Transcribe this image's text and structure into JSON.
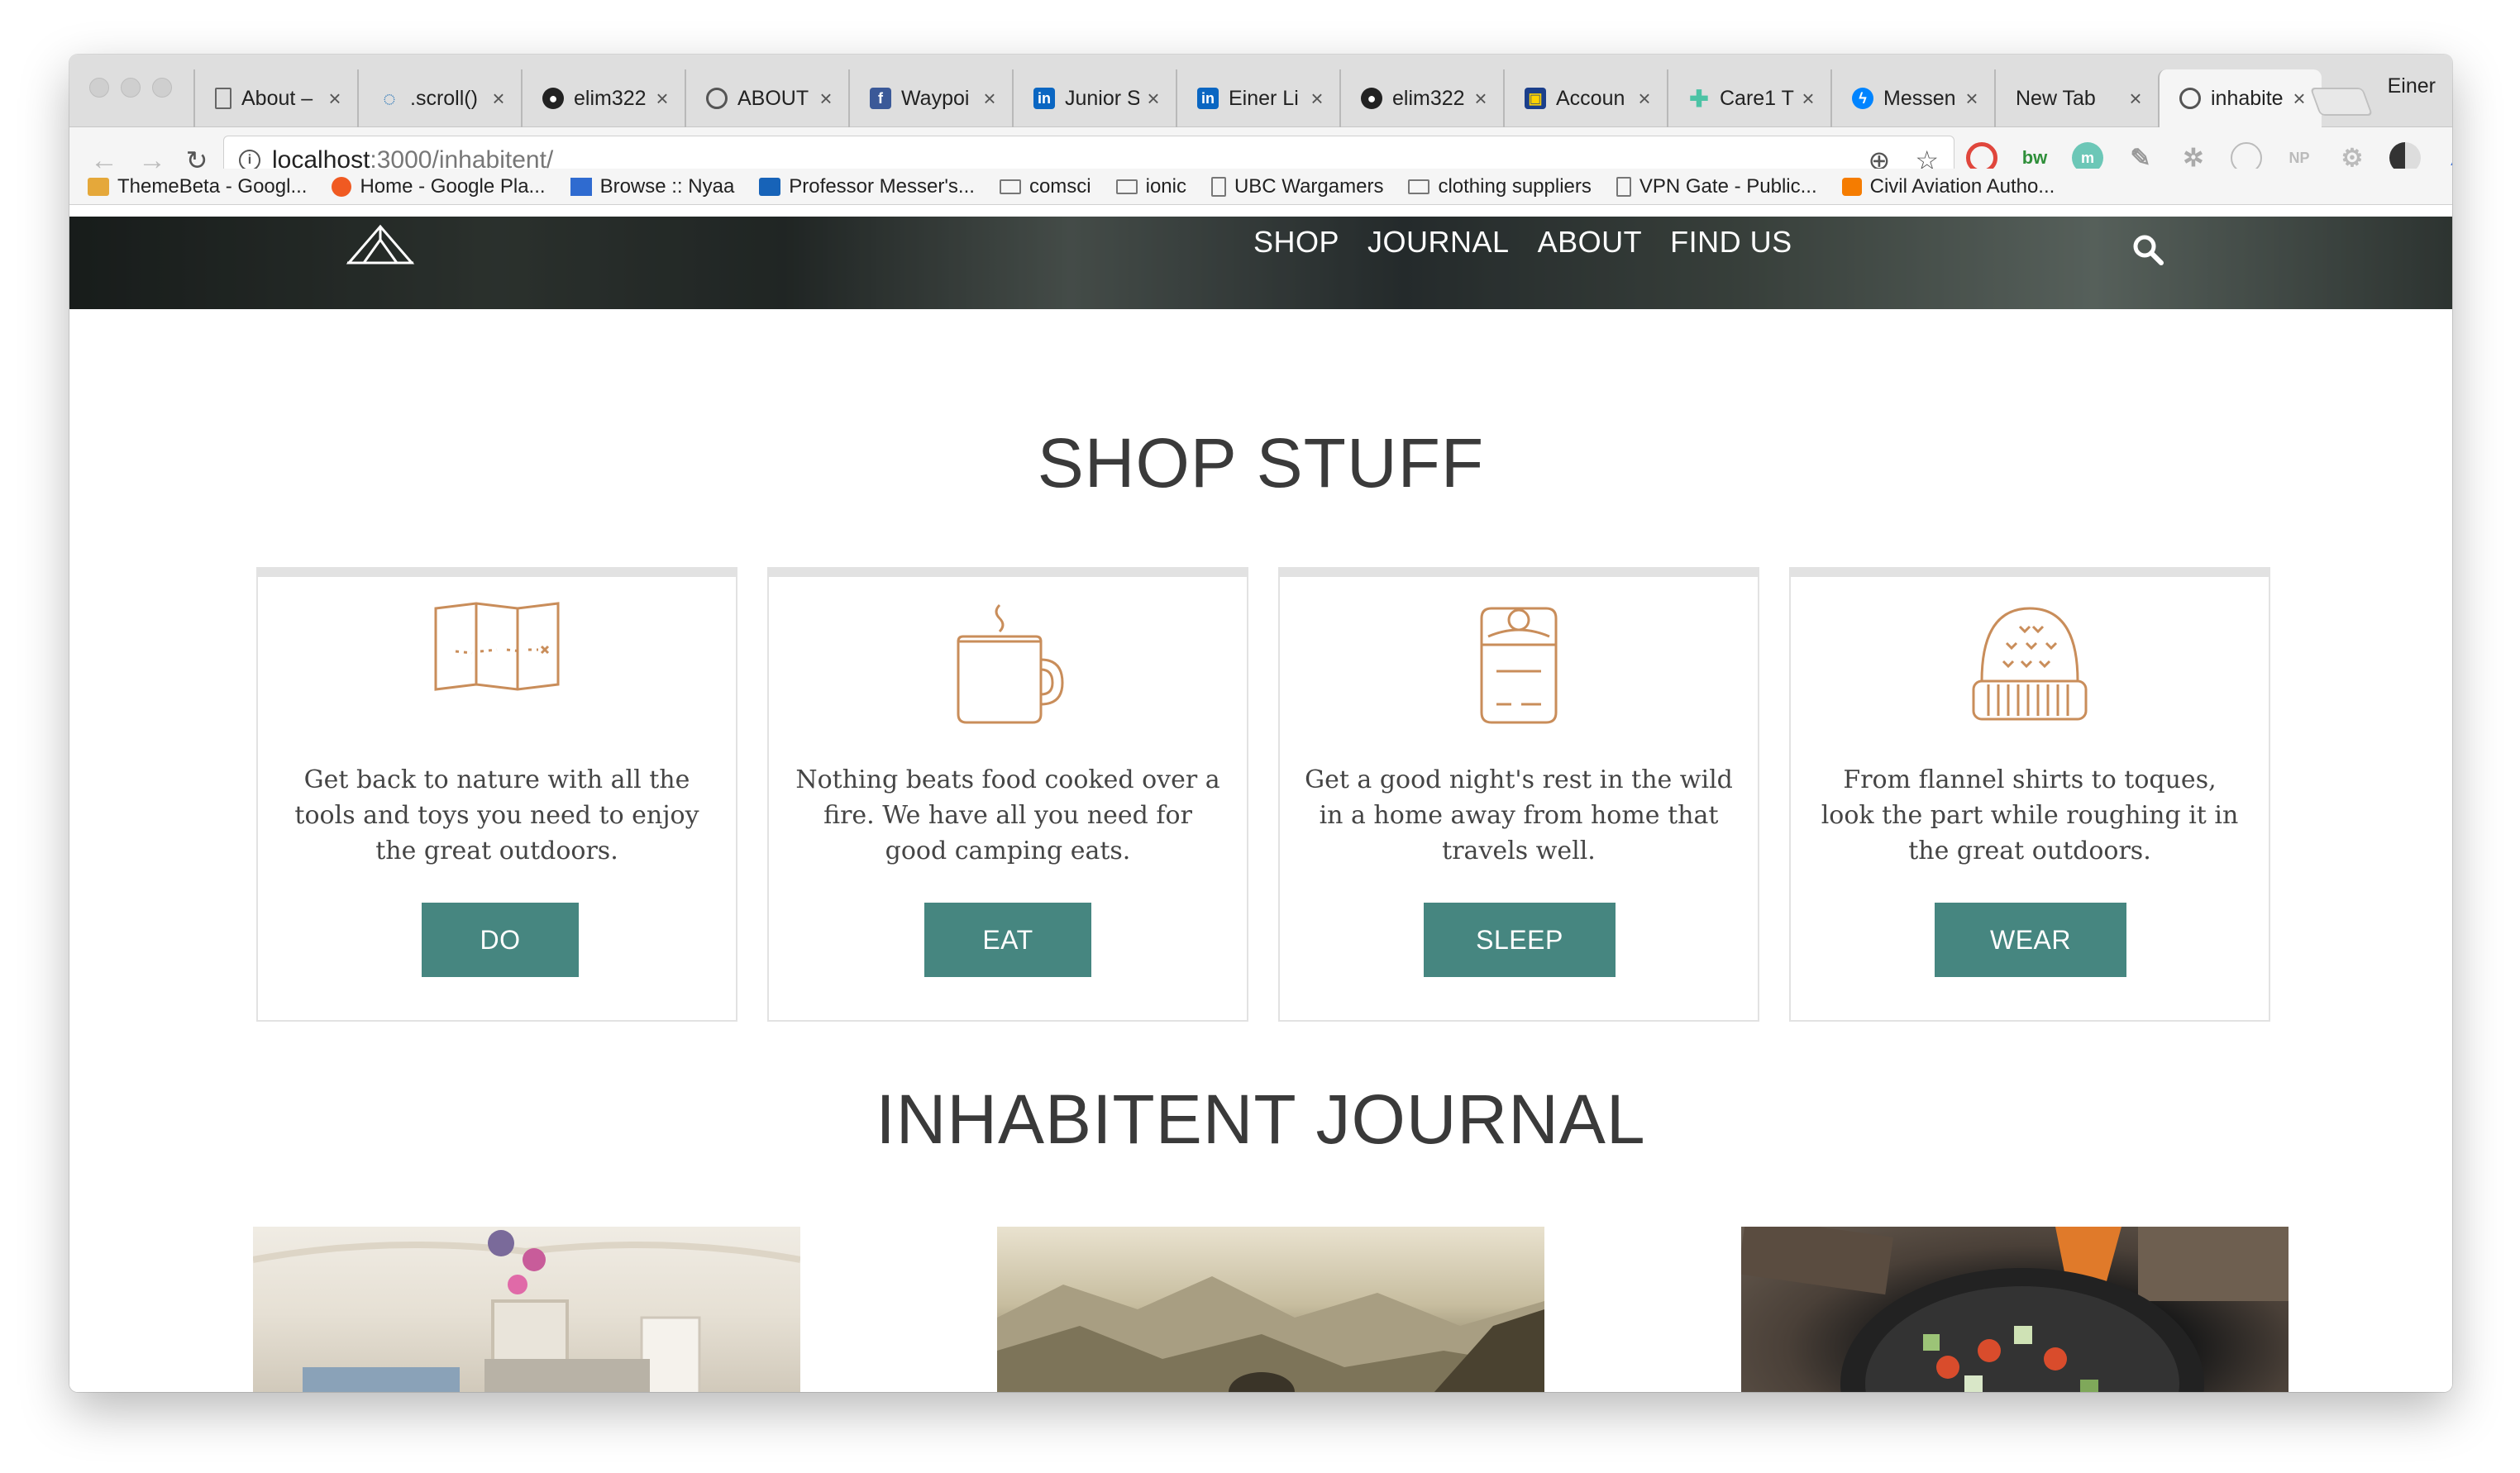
{
  "browser": {
    "profile_name": "Einer",
    "tabs": [
      {
        "title": "About –",
        "icon": "page-icon",
        "active": false
      },
      {
        "title": ".scroll()",
        "icon": "jquery-icon",
        "active": false
      },
      {
        "title": "elim322",
        "icon": "github-icon",
        "active": false
      },
      {
        "title": "ABOUT",
        "icon": "globe-icon",
        "active": false
      },
      {
        "title": "Waypoi",
        "icon": "facebook-icon",
        "active": false
      },
      {
        "title": "Junior S",
        "icon": "linkedin-icon",
        "active": false
      },
      {
        "title": "Einer Li",
        "icon": "linkedin-icon",
        "active": false
      },
      {
        "title": "elim322",
        "icon": "github-icon",
        "active": false
      },
      {
        "title": "Accoun",
        "icon": "bank-icon",
        "active": false
      },
      {
        "title": "Care1 T",
        "icon": "care-icon",
        "active": false
      },
      {
        "title": "Messen",
        "icon": "messenger-icon",
        "active": false
      },
      {
        "title": "New Tab",
        "icon": "",
        "active": false
      },
      {
        "title": "inhabite",
        "icon": "globe-icon",
        "active": true
      }
    ],
    "url_host": "localhost",
    "url_path": ":3000/inhabitent/",
    "bookmarks": [
      {
        "label": "ThemeBeta - Googl...",
        "icon": "themebeta-icon"
      },
      {
        "label": "Home - Google Pla...",
        "icon": "google-play-icon"
      },
      {
        "label": "Browse :: Nyaa",
        "icon": "nyaa-icon"
      },
      {
        "label": "Professor Messer's...",
        "icon": "messer-icon"
      },
      {
        "label": "comsci",
        "icon": "folder-icon"
      },
      {
        "label": "ionic",
        "icon": "folder-icon"
      },
      {
        "label": "UBC Wargamers",
        "icon": "page-icon"
      },
      {
        "label": "clothing suppliers",
        "icon": "folder-icon"
      },
      {
        "label": "VPN Gate - Public...",
        "icon": "page-icon"
      },
      {
        "label": "Civil Aviation Autho...",
        "icon": "blogger-icon"
      }
    ]
  },
  "site": {
    "nav": [
      "SHOP",
      "JOURNAL",
      "ABOUT",
      "FIND US"
    ],
    "shop_title": "SHOP STUFF",
    "journal_title": "INHABITENT JOURNAL",
    "accent_color": "#468680",
    "icon_color": "#c98d5a",
    "cards": [
      {
        "icon": "map-icon",
        "text": "Get back to nature with all the tools and toys you need to enjoy the great outdoors.",
        "button": "DO"
      },
      {
        "icon": "mug-icon",
        "text": "Nothing beats food cooked over a fire. We have all you need for good camping eats.",
        "button": "EAT"
      },
      {
        "icon": "sleeping-bag-icon",
        "text": "Get a good night's rest in the wild in a home away from home that travels well.",
        "button": "SLEEP"
      },
      {
        "icon": "toque-icon",
        "text": "From flannel shirts to toques, look the part while roughing it in the great outdoors.",
        "button": "WEAR"
      }
    ],
    "journal_photos": [
      "tent-interior-photo",
      "mountain-sunrise-photo",
      "campfire-pan-photo"
    ]
  }
}
